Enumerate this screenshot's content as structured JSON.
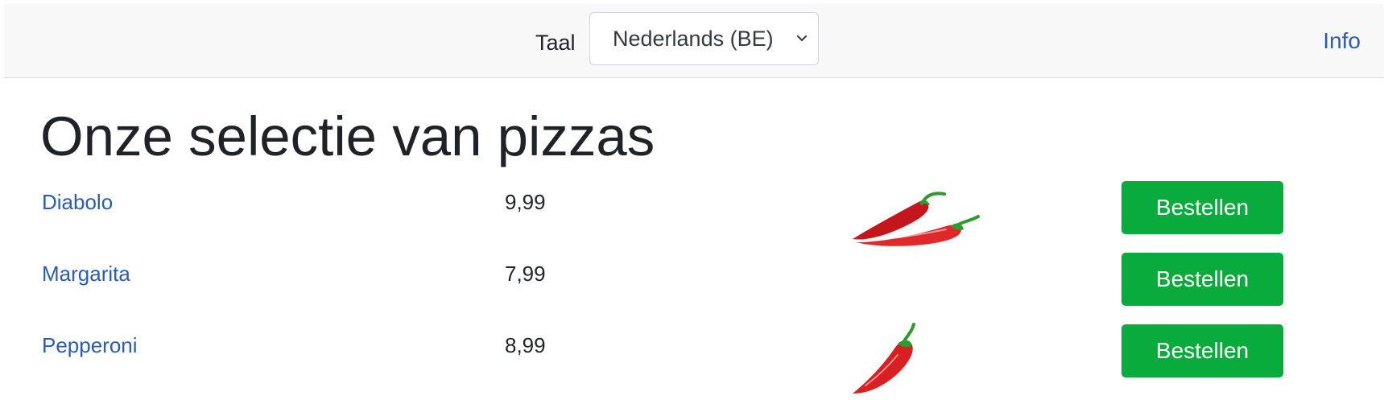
{
  "header": {
    "language_label": "Taal",
    "language_select_value": "Nederlands (BE)",
    "info_link": "Info"
  },
  "main": {
    "title": "Onze selectie van pizzas",
    "pizzas": [
      {
        "name": "Diabolo",
        "price": "9,99",
        "spice_icon": "two-chili-peppers-icon",
        "order_label": "Bestellen"
      },
      {
        "name": "Margarita",
        "price": "7,99",
        "spice_icon": "",
        "order_label": "Bestellen"
      },
      {
        "name": "Pepperoni",
        "price": "8,99",
        "spice_icon": "chili-pepper-icon",
        "order_label": "Bestellen"
      }
    ]
  },
  "colors": {
    "topbar_bg": "#f8f8f8",
    "link": "#2a5db0",
    "button_bg": "#09ab3c",
    "button_text": "#ffffff",
    "chili_red": "#d91f1f",
    "chili_stem": "#2e9b2e"
  }
}
